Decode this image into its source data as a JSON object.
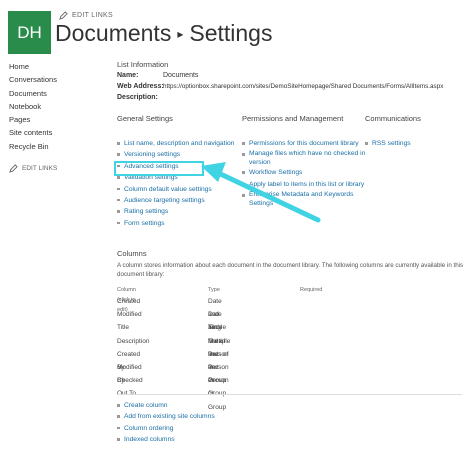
{
  "site": {
    "logo_text": "DH",
    "edit_links_top": "EDIT LINKS",
    "title_part1": "Documents",
    "title_separator": "▸",
    "title_part2": "Settings"
  },
  "leftnav": {
    "items": [
      "Home",
      "Conversations",
      "Documents",
      "Notebook",
      "Pages",
      "Site contents",
      "Recycle Bin"
    ],
    "edit_links": "EDIT LINKS"
  },
  "list_info": {
    "heading": "List Information",
    "name_label": "Name:",
    "name_value": "Documents",
    "address_label": "Web Address:",
    "address_value": "https://optionbox.sharepoint.com/sites/DemoSiteHomepage/Shared Documents/Forms/AllItems.aspx",
    "description_label": "Description:"
  },
  "general_settings": {
    "heading": "General Settings",
    "links": [
      "List name, description and navigation",
      "Versioning settings",
      "Advanced settings",
      "Validation settings",
      "Column default value settings",
      "Audience targeting settings",
      "Rating settings",
      "Form settings"
    ]
  },
  "permissions": {
    "heading": "Permissions and Management",
    "links": [
      [
        "Permissions for this document library"
      ],
      [
        "Manage files which have no checked in",
        "version"
      ],
      [
        "Workflow Settings"
      ],
      [
        "Apply label to items in this list or library"
      ],
      [
        "Enterprise Metadata and Keywords",
        "Settings"
      ]
    ]
  },
  "communications": {
    "heading": "Communications",
    "links": [
      "RSS settings"
    ]
  },
  "columns": {
    "heading": "Columns",
    "description": "A column stores information about each document in the document library. The following columns are currently available in this document library:",
    "headers": [
      "Column (click to edit)",
      "Type",
      "Required"
    ],
    "rows": [
      [
        "Created",
        "Date and Time"
      ],
      [
        "Modified",
        "Date and Time"
      ],
      [
        "Title",
        "Single line of text"
      ],
      [
        "Description",
        "Multiple lines of text"
      ],
      [
        "Created By",
        "Person or Group"
      ],
      [
        "Modified By",
        "Person or Group"
      ],
      [
        "Checked Out To",
        "Person or Group"
      ]
    ],
    "actions": [
      "Create column",
      "Add from existing site columns",
      "Column ordering",
      "Indexed columns"
    ]
  },
  "colors": {
    "logo": "#2a8c4a",
    "link": "#1a6fa6",
    "annotation": "#3fd3e3"
  }
}
